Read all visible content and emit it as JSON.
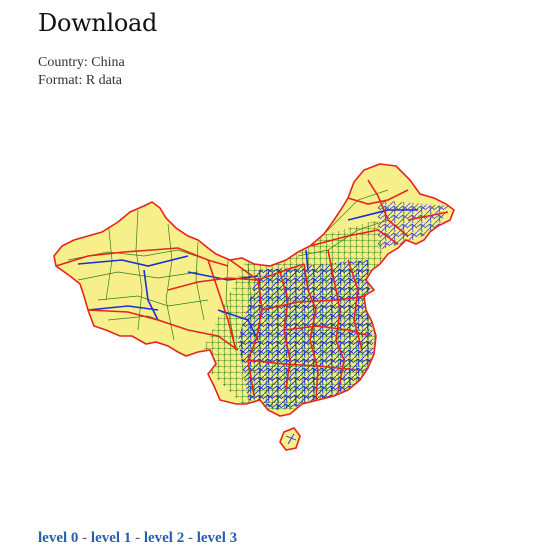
{
  "page": {
    "title": "Download"
  },
  "meta": {
    "country_line": "Country: China",
    "format_line": "Format: R data"
  },
  "map": {
    "colors": {
      "land_fill": "#f7f08a",
      "province_border": "#e8231c",
      "prefecture_border": "#1a2fd6",
      "county_border": "#2f7d1e"
    }
  },
  "levels": {
    "separator": "-",
    "items": [
      {
        "label": "level 0",
        "color": "#2a5db0"
      },
      {
        "label": "level 1",
        "color": "#2a5db0"
      },
      {
        "label": "level 2",
        "color": "#2a5db0"
      },
      {
        "label": "level 3",
        "color": "#2a5db0"
      }
    ]
  }
}
